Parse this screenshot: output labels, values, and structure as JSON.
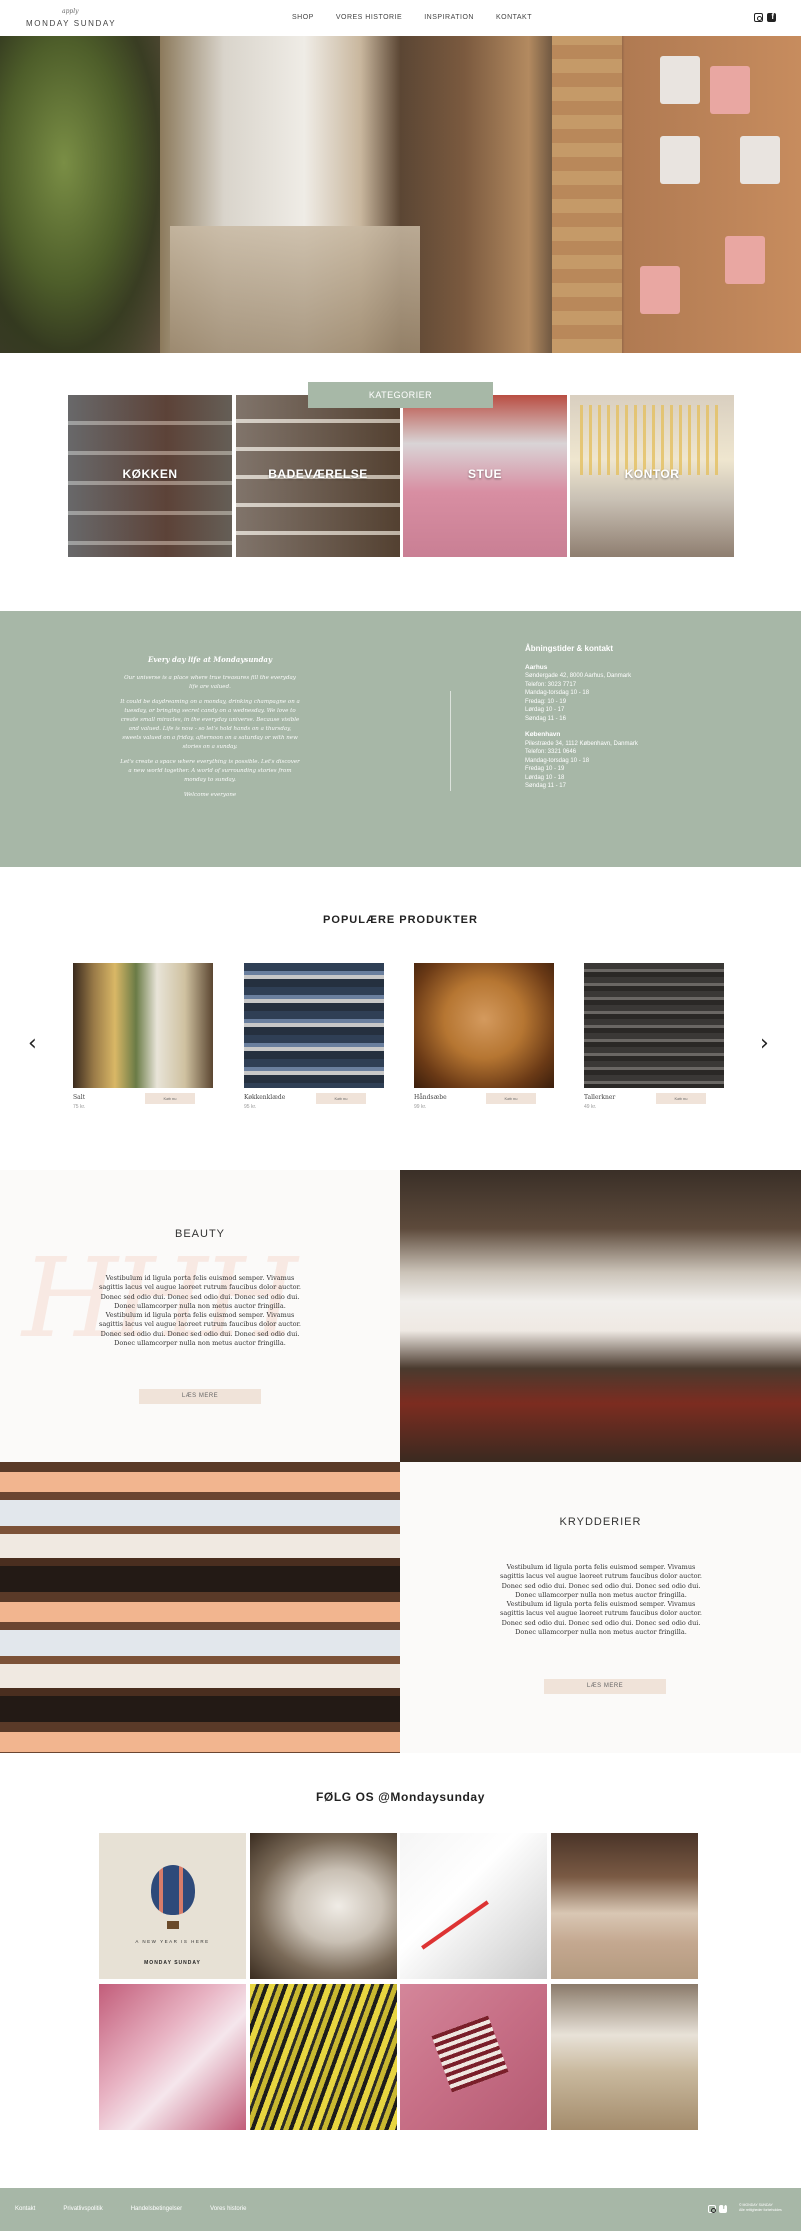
{
  "header": {
    "logo_small": "apply",
    "logo_text": "MONDAY SUNDAY",
    "nav": [
      "SHOP",
      "VORES HISTORIE",
      "INSPIRATION",
      "KONTAKT"
    ],
    "social_icons": [
      "instagram-icon",
      "facebook-icon"
    ]
  },
  "categories": {
    "button": "KATEGORIER",
    "items": [
      "KØKKEN",
      "BADEVÆRELSE",
      "STUE",
      "KONTOR"
    ]
  },
  "info": {
    "poem_title": "Every day life at Mondaysunday",
    "poem_lines": [
      "Our universe is a place where true treasures fill the everyday life are valued.",
      "It could be daydreaming on a monday, drinking champagne on a tuesday, or bringing secret candy on a wednesday. We love to create small miracles, in the everyday universe. Because visible and valued. Life is now - so let's hold hands on a thursday, sweets valued on a friday, afternoon on a saturday or with new stories on a sunday.",
      "Let's create a space where everything is possible. Let's discover a new world together. A world of surrounding stories from monday to sunday.",
      "Welcome everyone"
    ],
    "hours_title": "Åbningstider & kontakt",
    "aarhus_title": "Aarhus",
    "aarhus_lines": [
      "Søndergade 42, 8000 Aarhus, Danmark",
      "Telefon: 3023 7717",
      "Mandag-torsdag 10 - 18",
      "Fredag: 10 - 19",
      "Lørdag 10 - 17",
      "Søndag 11 - 16"
    ],
    "kbh_title": "København",
    "kbh_lines": [
      "Pilestræde 34, 1112 København, Danmark",
      "Telefon: 3321 0646",
      "Mandag-torsdag 10 - 18",
      "Fredag 10 - 19",
      "Lørdag 10 - 18",
      "Søndag 11 - 17"
    ]
  },
  "popular": {
    "title": "POPULÆRE PRODUKTER",
    "prev_icon": "chevron-left-icon",
    "next_icon": "chevron-right-icon",
    "products": [
      {
        "name": "Salt",
        "price": "75 kr.",
        "button": "Køb nu"
      },
      {
        "name": "Køkkenklæde",
        "price": "95 kr.",
        "button": "Køb nu"
      },
      {
        "name": "Håndsæbe",
        "price": "99 kr.",
        "button": "Køb nu"
      },
      {
        "name": "Tallerkner",
        "price": "49 kr.",
        "button": "Køb nu"
      }
    ]
  },
  "beauty": {
    "title": "BEAUTY",
    "body": "Vestibulum id ligula porta felis euismod semper. Vivamus sagittis lacus vel augue laoreet rutrum faucibus dolor auctor. Donec sed odio dui. Donec sed odio dui. Donec sed odio dui. Donec ullamcorper nulla non metus auctor fringilla. Vestibulum id ligula porta felis euismod semper. Vivamus sagittis lacus vel augue laoreet rutrum faucibus dolor auctor. Donec sed odio dui. Donec sed odio dui. Donec sed odio dui. Donec ullamcorper nulla non metus auctor fringilla.",
    "button": "LÆS MERE",
    "deco": "HHH"
  },
  "krydderier": {
    "title": "KRYDDERIER",
    "body": "Vestibulum id ligula porta felis euismod semper. Vivamus sagittis lacus vel augue laoreet rutrum faucibus dolor auctor. Donec sed odio dui. Donec sed odio dui. Donec sed odio dui. Donec ullamcorper nulla non metus auctor fringilla. Vestibulum id ligula porta felis euismod semper. Vivamus sagittis lacus vel augue laoreet rutrum faucibus dolor auctor. Donec sed odio dui. Donec sed odio dui. Donec sed odio dui. Donec ullamcorper nulla non metus auctor fringilla.",
    "button": "LÆS MERE"
  },
  "follow": {
    "title": "FØLG OS @Mondaysunday",
    "tile1_text": "A NEW YEAR IS HERE",
    "tile1_brand": "MONDAY SUNDAY"
  },
  "footer": {
    "links": [
      "Kontakt",
      "Privatlivspolitik",
      "Handelsbetingelser",
      "Vores historie"
    ],
    "copyright": [
      "© MONDAY SUNDAY",
      "Alle rettigheder forbeholdes"
    ]
  }
}
